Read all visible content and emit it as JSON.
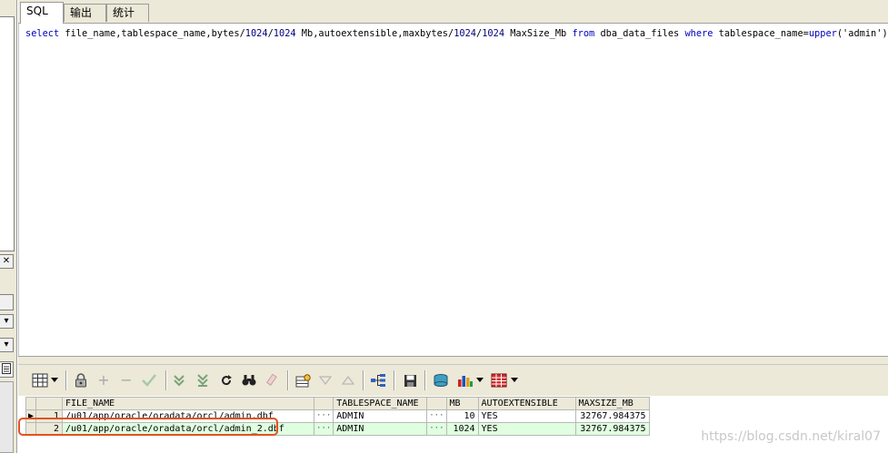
{
  "tabs": [
    {
      "label": "SQL",
      "active": true
    },
    {
      "label": "输出",
      "active": false
    },
    {
      "label": "统计",
      "active": false
    }
  ],
  "editor": {
    "sql_tokens": [
      {
        "t": "select",
        "k": "kw"
      },
      {
        "t": " file_name,tablespace_name,bytes/",
        "k": ""
      },
      {
        "t": "1024",
        "k": "num"
      },
      {
        "t": "/",
        "k": ""
      },
      {
        "t": "1024",
        "k": "num"
      },
      {
        "t": " Mb,autoextensible,maxbytes/",
        "k": ""
      },
      {
        "t": "1024",
        "k": "num"
      },
      {
        "t": "/",
        "k": ""
      },
      {
        "t": "1024",
        "k": "num"
      },
      {
        "t": " MaxSize_Mb ",
        "k": ""
      },
      {
        "t": "from",
        "k": "kw"
      },
      {
        "t": " dba_data_files ",
        "k": ""
      },
      {
        "t": "where",
        "k": "kw"
      },
      {
        "t": " tablespace_name=",
        "k": ""
      },
      {
        "t": "upper",
        "k": "kw"
      },
      {
        "t": "('admin');",
        "k": "str"
      }
    ]
  },
  "left_panel": {
    "close_glyph": "✕",
    "dropdown_glyph": "▾"
  },
  "toolbar": {
    "icons": [
      "grid-view-icon",
      "dropdown-arrow-icon",
      "lock-icon",
      "add-row-icon",
      "delete-row-icon",
      "post-changes-icon",
      "fetch-next-icon",
      "fetch-last-icon",
      "refresh-icon",
      "find-icon",
      "clear-icon",
      "query-by-example-icon",
      "filter-down-icon",
      "filter-up-icon",
      "tree-icon",
      "save-icon",
      "export-icon",
      "chart-icon",
      "table-icon"
    ]
  },
  "grid": {
    "columns": [
      "FILE_NAME",
      "TABLESPACE_NAME",
      "MB",
      "AUTOEXTENSIBLE",
      "MAXSIZE_MB"
    ],
    "rows": [
      {
        "num": "1",
        "file_name": "/u01/app/oracle/oradata/orcl/admin.dbf",
        "tablespace_name": "ADMIN",
        "mb": "10",
        "autoextensible": "YES",
        "maxsize_mb": "32767.984375"
      },
      {
        "num": "2",
        "file_name": "/u01/app/oracle/oradata/orcl/admin_2.dbf",
        "tablespace_name": "ADMIN",
        "mb": "1024",
        "autoextensible": "YES",
        "maxsize_mb": "32767.984375"
      }
    ],
    "ellipsis": "···",
    "current_row_marker": "▶"
  },
  "watermark": "https://blog.csdn.net/kiral07",
  "colors": {
    "highlight": "#e0531f",
    "selected_row": "#e0ffe0",
    "keyword": "#0000c0"
  }
}
